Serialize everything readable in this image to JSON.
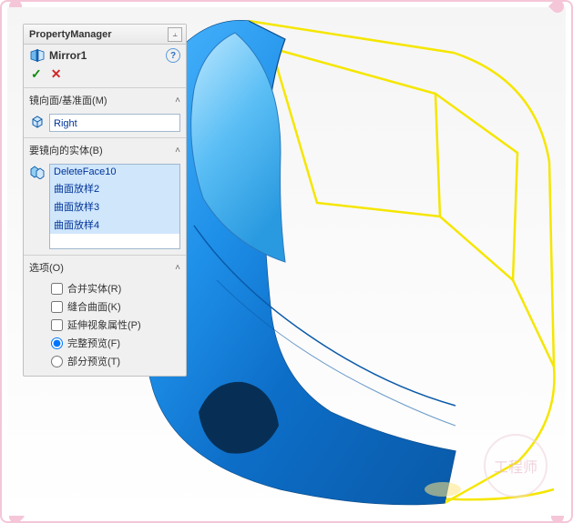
{
  "header": {
    "title": "PropertyManager"
  },
  "feature": {
    "name": "Mirror1",
    "help": "?"
  },
  "actions": {
    "ok": "✓",
    "cancel": "✕"
  },
  "sections": {
    "mirror_plane": {
      "label": "镜向面/基准面(M)",
      "value": "Right"
    },
    "bodies": {
      "label": "要镜向的实体(B)",
      "items": [
        "DeleteFace10",
        "曲面放样2",
        "曲面放样3",
        "曲面放样4"
      ]
    },
    "options": {
      "label": "选项(O)",
      "merge": "合并实体(R)",
      "knit": "缝合曲面(K)",
      "propagate": "延伸视象属性(P)",
      "full_preview": "完整预览(F)",
      "partial_preview": "部分预览(T)"
    }
  },
  "watermark": "工程师",
  "icons": {
    "pin": "⫠"
  }
}
